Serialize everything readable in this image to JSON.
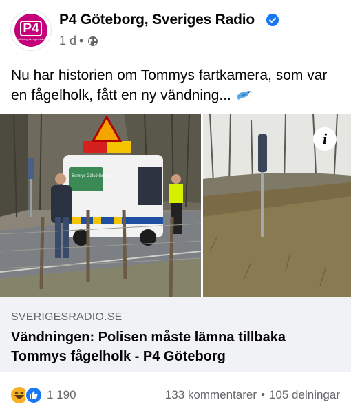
{
  "post": {
    "page_name": "P4 Göteborg, Sveriges Radio",
    "avatar_logo": "P4",
    "avatar_sub": "göteborg sverigesradio",
    "time": "1 d",
    "meta_separator": "•",
    "privacy_icon": "globe-icon",
    "verified_icon": "verified-badge-icon",
    "text": "Nu har historien om Tommys fartkamera, som var en fågelholk, fått en ny vändning...",
    "emoji": "bird-emoji"
  },
  "photos": {
    "left_van_text": "Semrys Gälsö Group",
    "info_icon_label": "i"
  },
  "link": {
    "domain": "SVERIGESRADIO.SE",
    "title": "Vändningen: Polisen måste lämna tillbaka Tommys fågelholk - P4 Göteborg"
  },
  "stats": {
    "reaction_icons": [
      "haha-icon",
      "like-icon"
    ],
    "reaction_count": "1 190",
    "comments": "133 kommentarer",
    "separator": "•",
    "shares": "105 delningar"
  },
  "colors": {
    "brand_p4": "#c4007a",
    "verified": "#1877f2",
    "muted_text": "#65676b",
    "link_card_bg": "#f0f2f5"
  }
}
